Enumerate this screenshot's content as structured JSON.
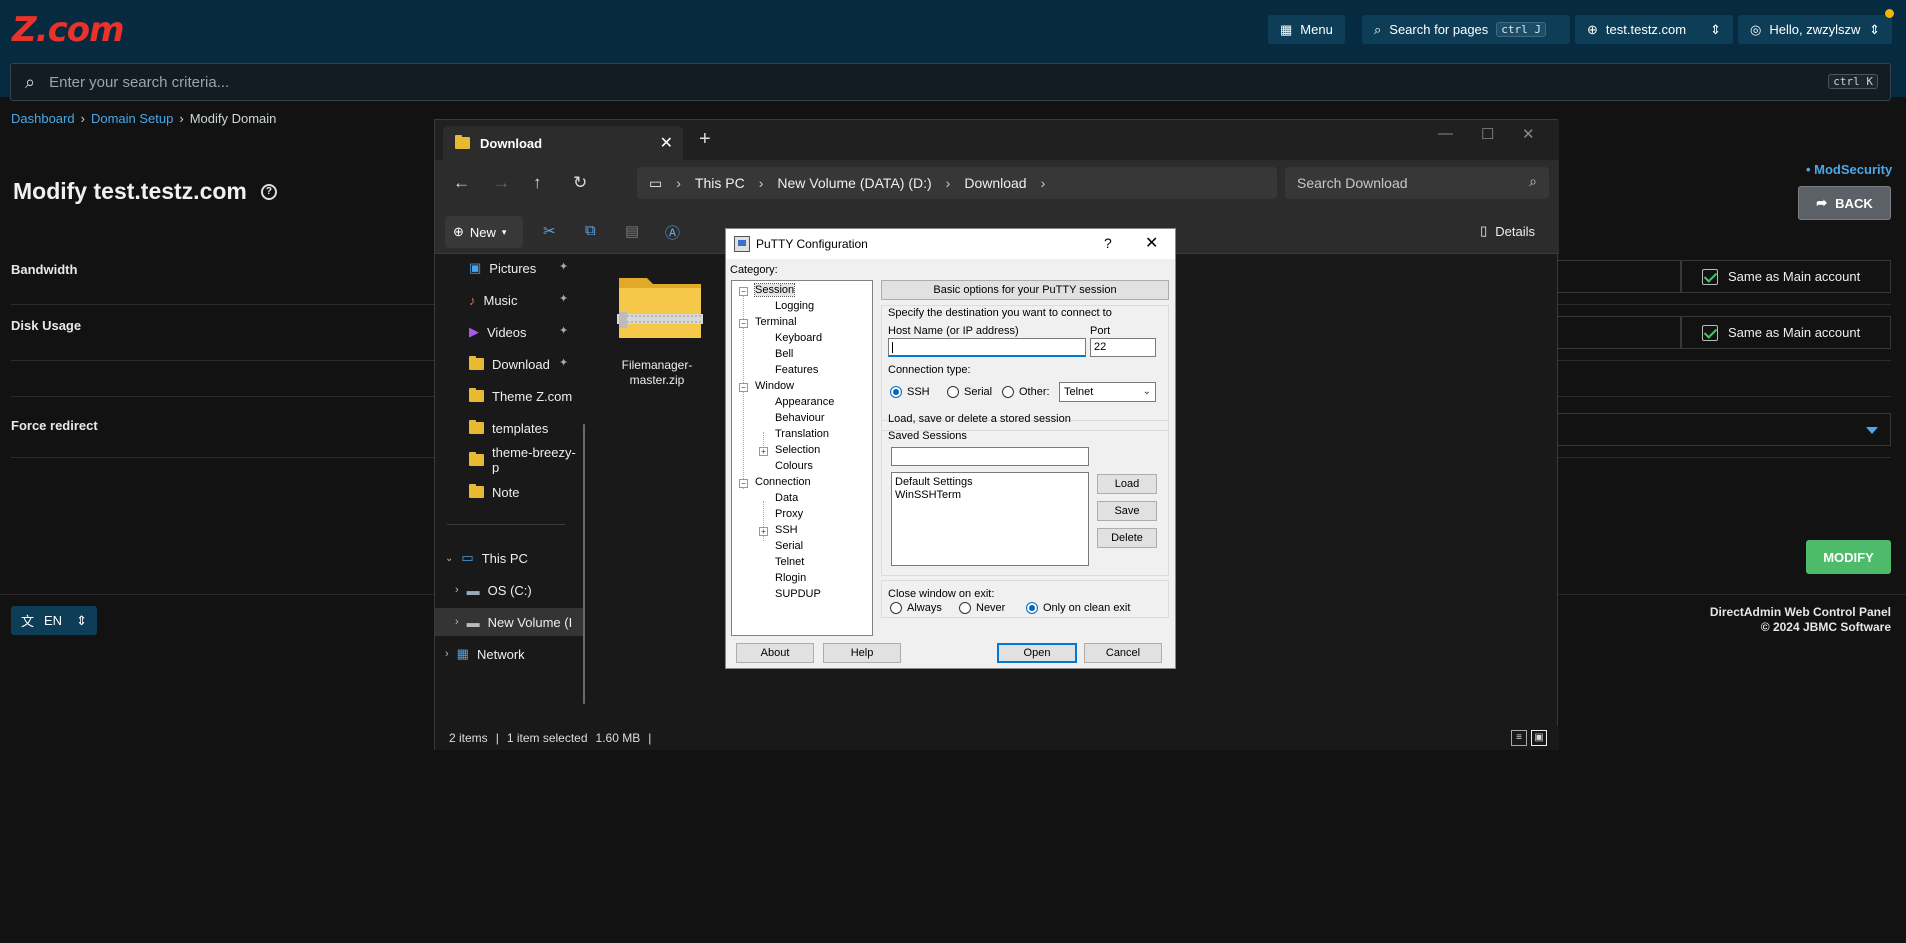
{
  "app": {
    "logo": "Z.com",
    "menu_label": "Menu",
    "search_pages_label": "Search for pages",
    "search_pages_kbd": "ctrl J",
    "domain_select": "test.testz.com",
    "user_greeting": "Hello, zwzylszw",
    "search_placeholder": "Enter your search criteria...",
    "search_kbd": "ctrl K"
  },
  "breadcrumb": {
    "items": [
      "Dashboard",
      "Domain Setup",
      "Modify Domain"
    ],
    "sep": "›"
  },
  "page": {
    "title": "Modify test.testz.com",
    "modsecurity": "• ModSecurity",
    "back_label": "BACK",
    "bandwidth_label": "Bandwidth",
    "disk_usage_label": "Disk Usage",
    "force_redirect_label": "Force redirect",
    "same_as_main": "Same as Main account",
    "modify_label": "MODIFY",
    "lang": "EN",
    "footer_line1": "DirectAdmin Web Control Panel",
    "footer_line2": "© 2024 JBMC Software"
  },
  "explorer": {
    "tab_title": "Download",
    "address": [
      "This PC",
      "New Volume (DATA) (D:)",
      "Download"
    ],
    "search_placeholder": "Search Download",
    "new_label": "New",
    "details_label": "Details",
    "sidebar": {
      "quick": [
        {
          "label": "Pictures",
          "pinned": true
        },
        {
          "label": "Music",
          "pinned": true
        },
        {
          "label": "Videos",
          "pinned": true
        },
        {
          "label": "Download",
          "pinned": true
        },
        {
          "label": "Theme Z.com",
          "pinned": false
        },
        {
          "label": "templates",
          "pinned": false
        },
        {
          "label": "theme-breezy-p",
          "pinned": false
        },
        {
          "label": "Note",
          "pinned": false
        }
      ],
      "this_pc": "This PC",
      "os_c": "OS (C:)",
      "new_volume": "New Volume (I",
      "network": "Network"
    },
    "file_name": "Filemanager-master.zip",
    "status": {
      "items": "2 items",
      "selected": "1 item selected",
      "size": "1.60 MB"
    }
  },
  "putty": {
    "title": "PuTTY Configuration",
    "help_q": "?",
    "category_label": "Category:",
    "tree": [
      {
        "label": "Session",
        "level": 0,
        "box": "−",
        "selected": true
      },
      {
        "label": "Logging",
        "level": 1
      },
      {
        "label": "Terminal",
        "level": 0,
        "box": "−"
      },
      {
        "label": "Keyboard",
        "level": 1
      },
      {
        "label": "Bell",
        "level": 1
      },
      {
        "label": "Features",
        "level": 1
      },
      {
        "label": "Window",
        "level": 0,
        "box": "−"
      },
      {
        "label": "Appearance",
        "level": 1
      },
      {
        "label": "Behaviour",
        "level": 1
      },
      {
        "label": "Translation",
        "level": 1
      },
      {
        "label": "Selection",
        "level": 1,
        "box": "+"
      },
      {
        "label": "Colours",
        "level": 1
      },
      {
        "label": "Connection",
        "level": 0,
        "box": "−"
      },
      {
        "label": "Data",
        "level": 1
      },
      {
        "label": "Proxy",
        "level": 1
      },
      {
        "label": "SSH",
        "level": 1,
        "box": "+"
      },
      {
        "label": "Serial",
        "level": 1
      },
      {
        "label": "Telnet",
        "level": 1
      },
      {
        "label": "Rlogin",
        "level": 1
      },
      {
        "label": "SUPDUP",
        "level": 1
      }
    ],
    "header": "Basic options for your PuTTY session",
    "dest_label": "Specify the destination you want to connect to",
    "host_label": "Host Name (or IP address)",
    "host_value": "",
    "port_label": "Port",
    "port_value": "22",
    "conn_type_label": "Connection type:",
    "radio_ssh": "SSH",
    "radio_serial": "Serial",
    "radio_other": "Other:",
    "other_select": "Telnet",
    "sessions_group": "Load, save or delete a stored session",
    "saved_sessions_label": "Saved Sessions",
    "saved_sessions_value": "",
    "sessions": [
      "Default Settings",
      "WinSSHTerm"
    ],
    "load": "Load",
    "save": "Save",
    "delete": "Delete",
    "close_label": "Close window on exit:",
    "close_always": "Always",
    "close_never": "Never",
    "close_clean": "Only on clean exit",
    "about": "About",
    "help": "Help",
    "open": "Open",
    "cancel": "Cancel"
  }
}
